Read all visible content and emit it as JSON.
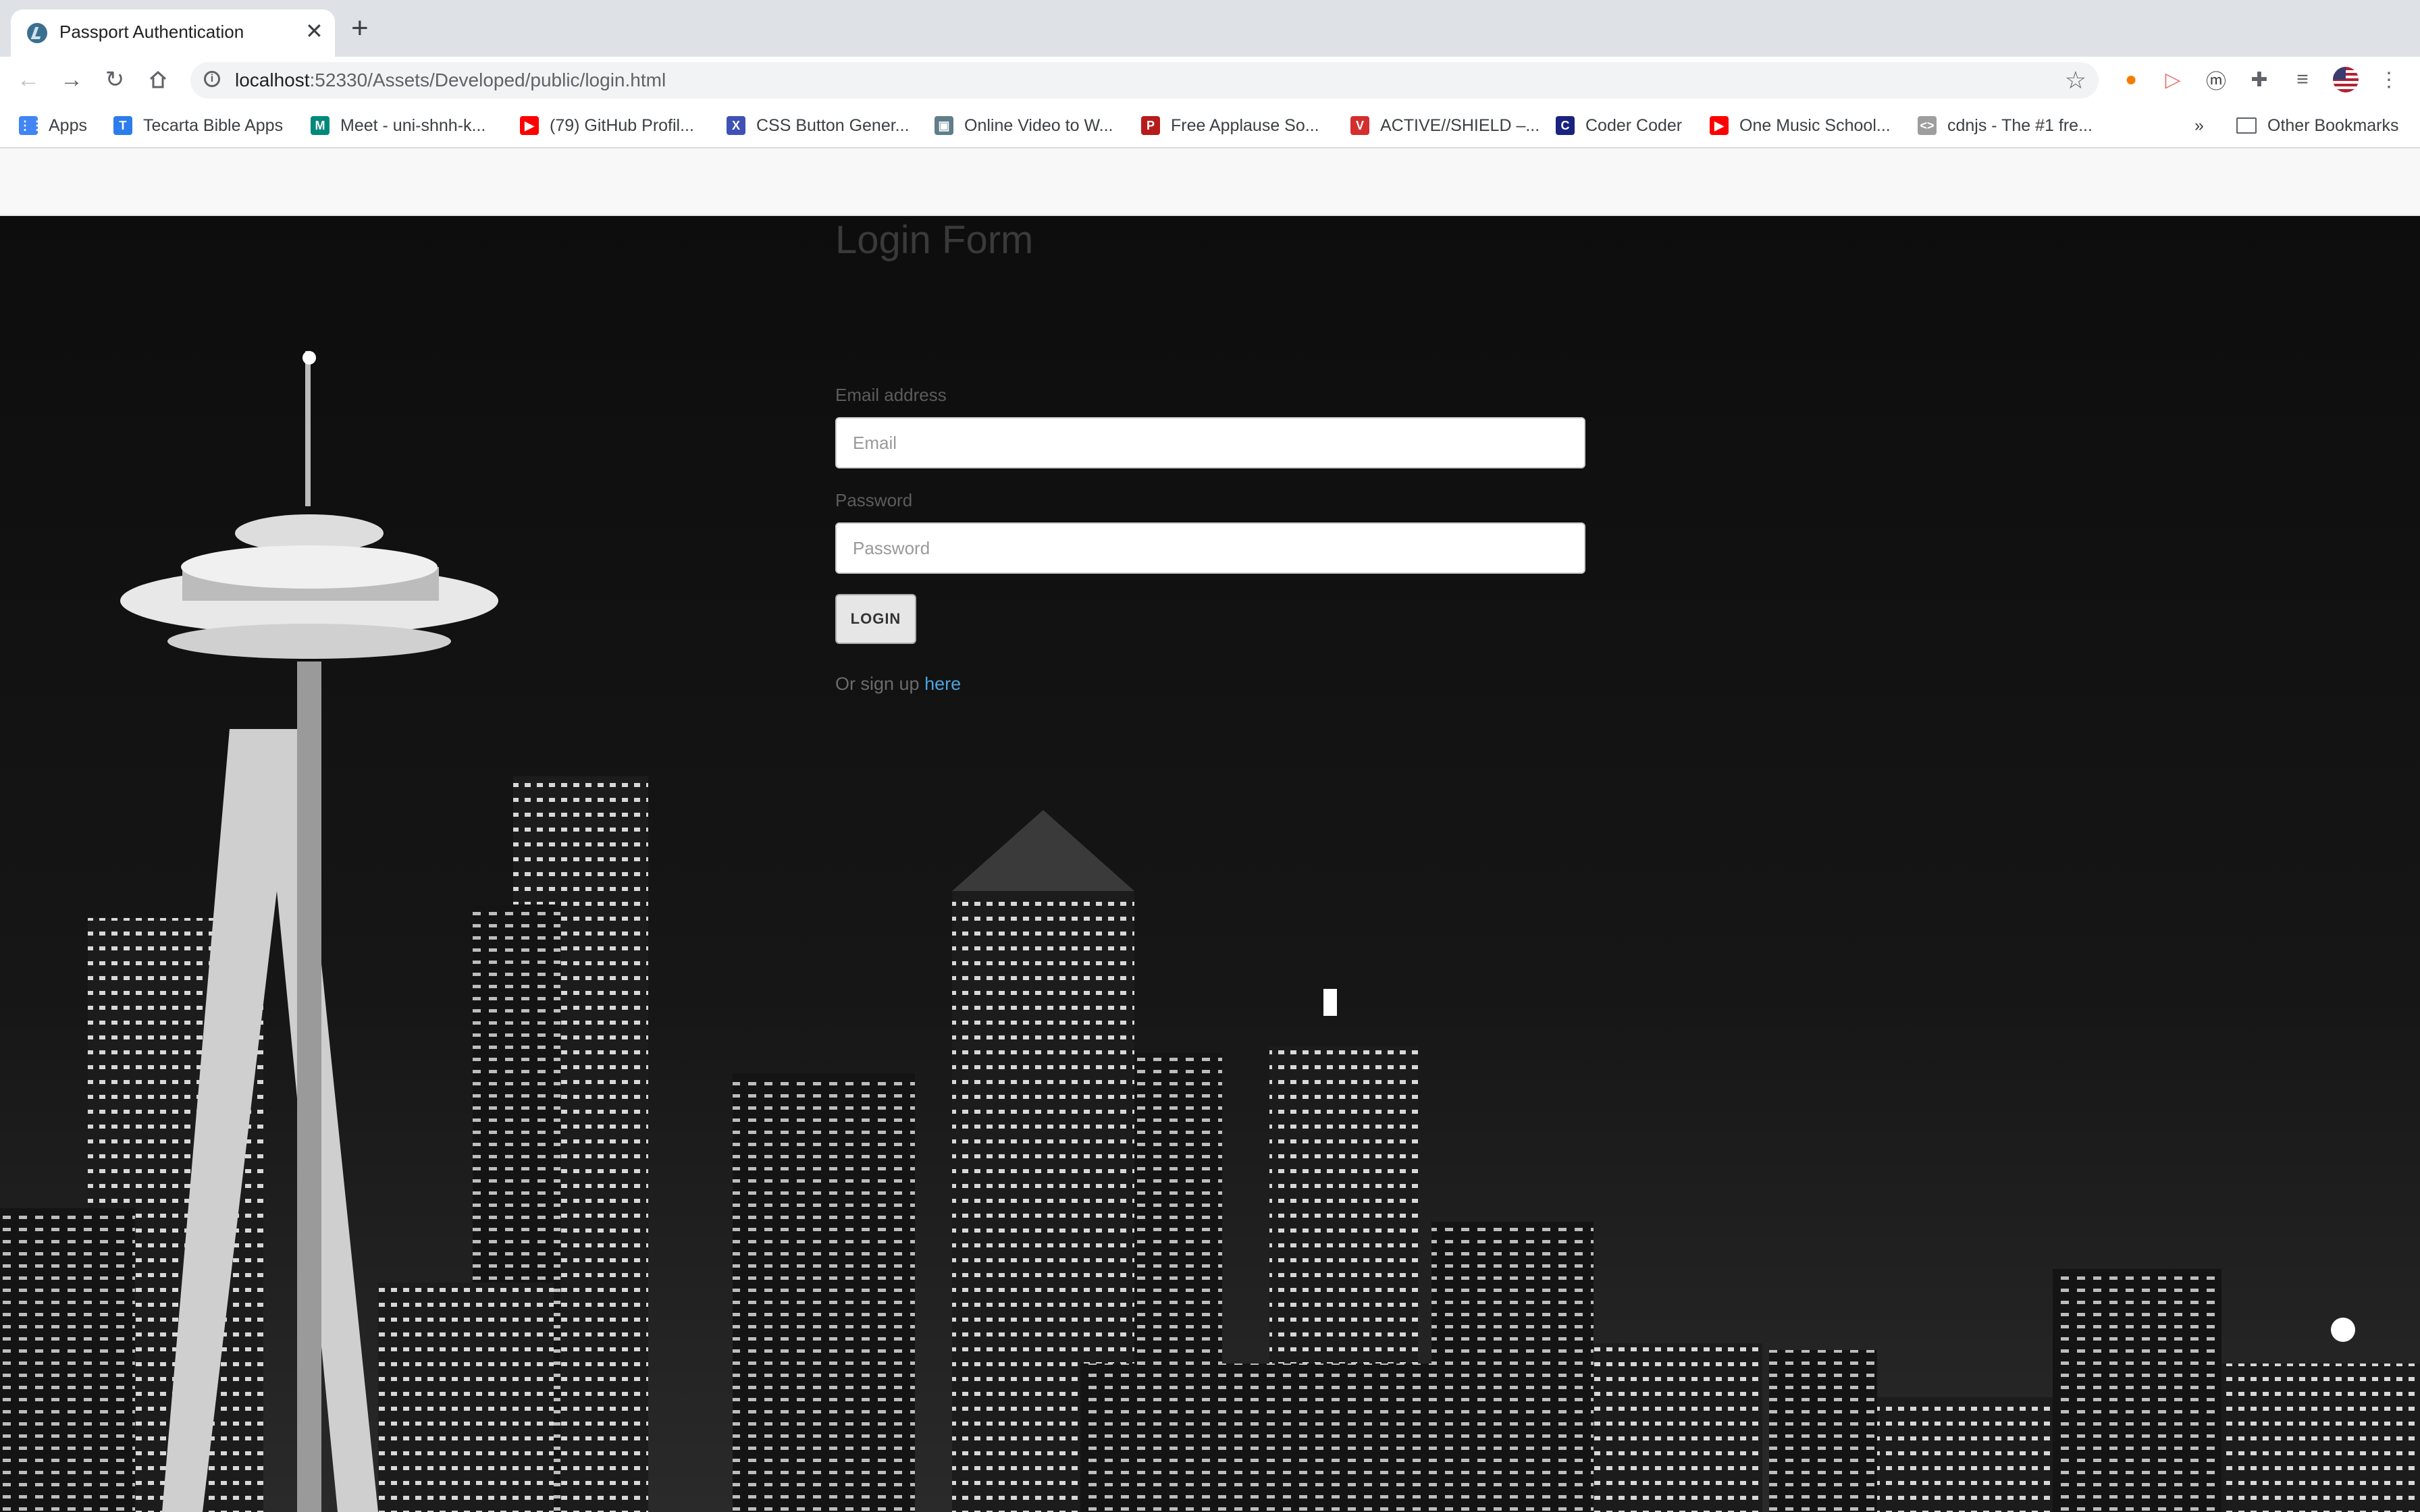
{
  "browser": {
    "tab_title": "Passport Authentication",
    "url_host": "localhost",
    "url_rest": ":52330/Assets/Developed/public/login.html"
  },
  "bookmarks": [
    {
      "label": "Apps",
      "icon": "apps-grid-icon",
      "color": "#4285f4"
    },
    {
      "label": "Tecarta Bible Apps",
      "icon": "tecarta-icon",
      "color": "#2b7de9"
    },
    {
      "label": "Meet - uni-shnh-k...",
      "icon": "meet-icon",
      "color": "#00897b"
    },
    {
      "label": "(79) GitHub Profil...",
      "icon": "youtube-icon",
      "color": "#ff0000"
    },
    {
      "label": "CSS Button Gener...",
      "icon": "css-x-icon",
      "color": "#3f51b5"
    },
    {
      "label": "Online Video to W...",
      "icon": "video-converter-icon",
      "color": "#607d8b"
    },
    {
      "label": "Free Applause So...",
      "icon": "pir-icon",
      "color": "#b71c1c"
    },
    {
      "label": "ACTIVE//SHIELD –...",
      "icon": "shield-v-icon",
      "color": "#d32f2f"
    },
    {
      "label": "Coder Coder",
      "icon": "coder-coder-icon",
      "color": "#1a237e"
    },
    {
      "label": "One Music School...",
      "icon": "youtube-icon",
      "color": "#ff0000"
    },
    {
      "label": "cdnjs - The #1 fre...",
      "icon": "code-brackets-icon",
      "color": "#9e9e9e"
    }
  ],
  "other_bookmarks": "Other Bookmarks",
  "form": {
    "title": "Login Form",
    "email_label": "Email address",
    "email_placeholder": "Email",
    "password_label": "Password",
    "password_placeholder": "Password",
    "login_button": "LOGIN",
    "signup_text": "Or sign up ",
    "signup_link": "here"
  }
}
